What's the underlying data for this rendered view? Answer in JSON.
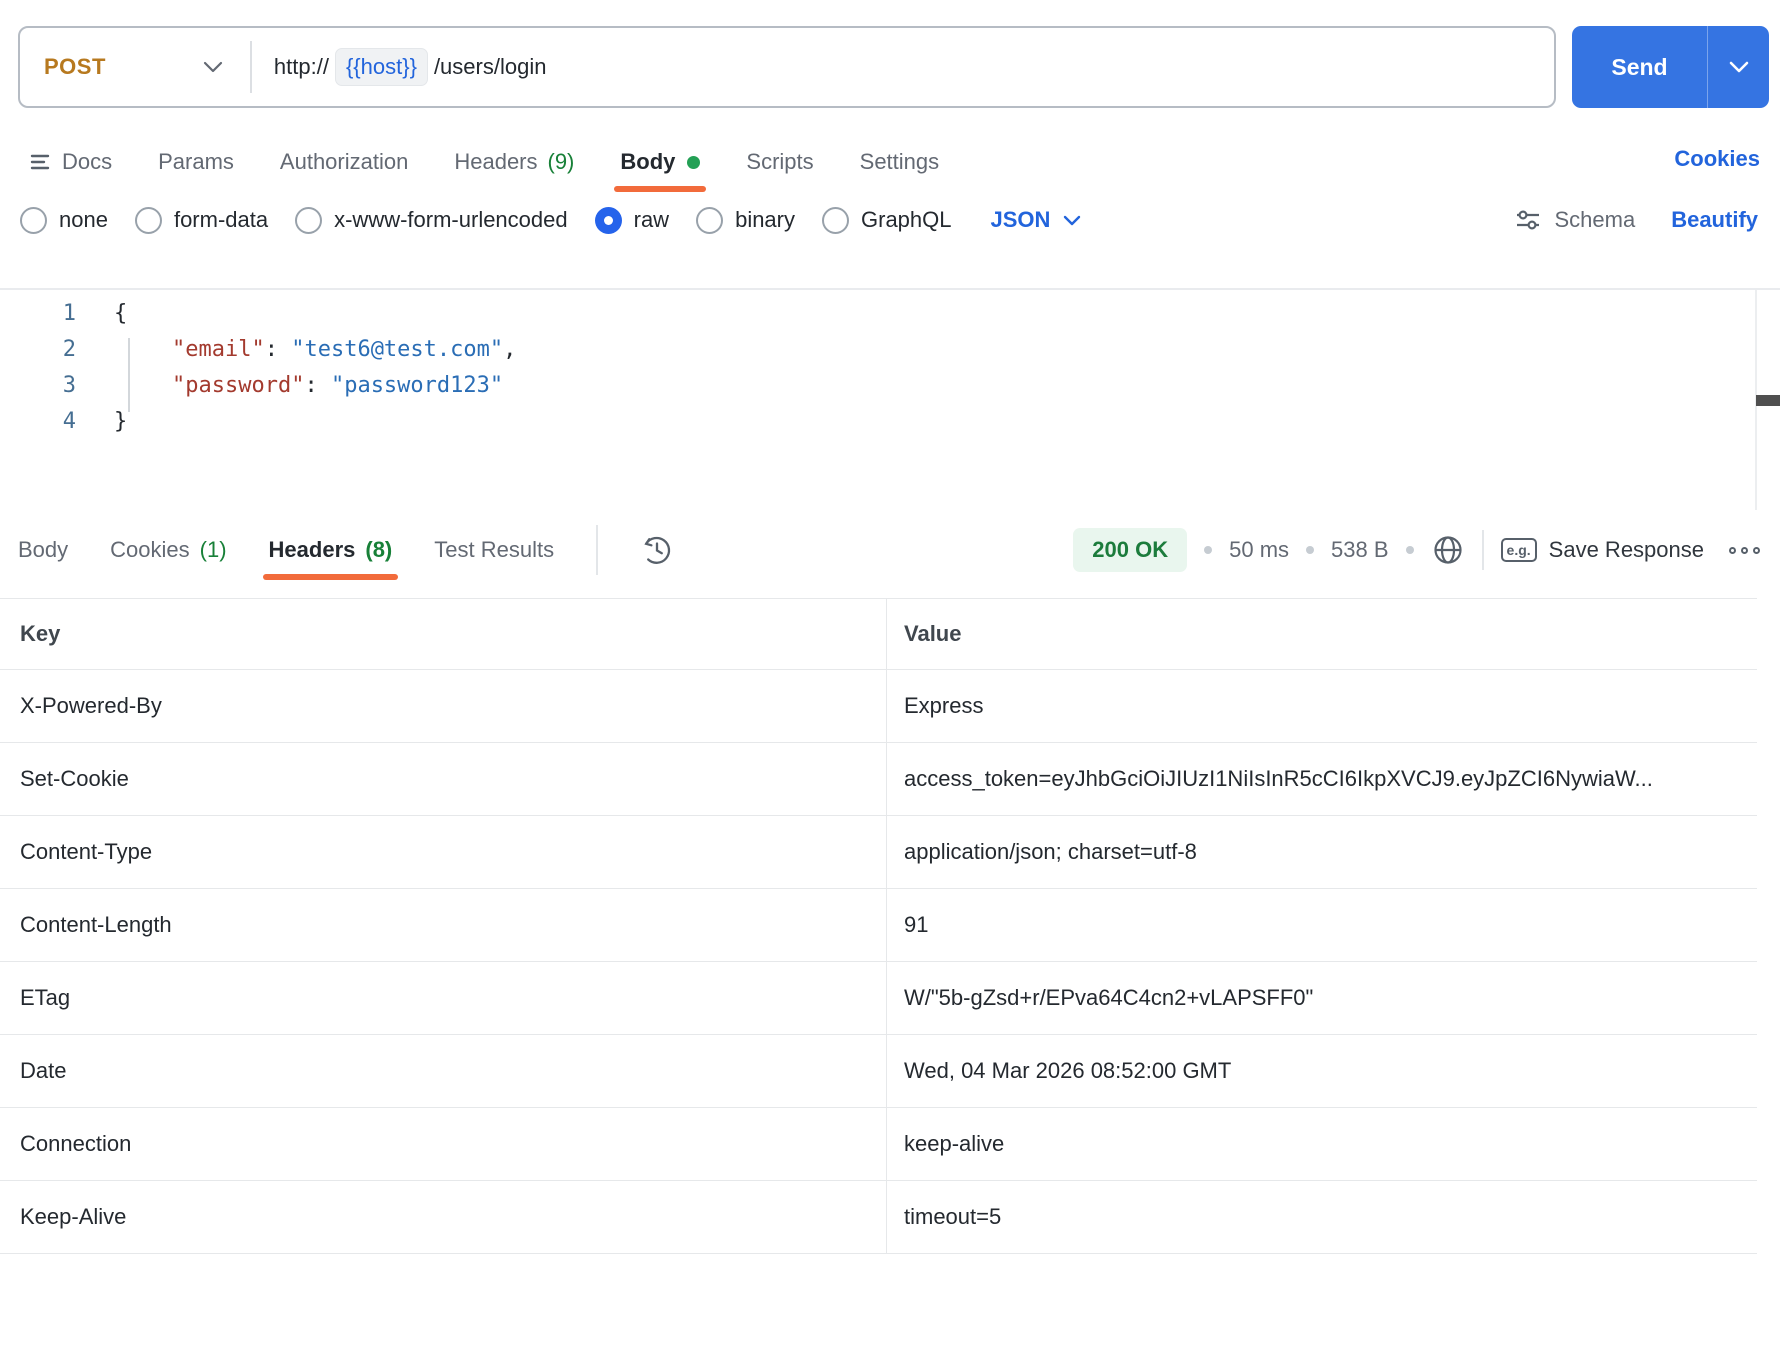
{
  "request_bar": {
    "method": "POST",
    "url_scheme": "http://",
    "url_host_var": "{{host}}",
    "url_path": "/users/login",
    "send_label": "Send"
  },
  "request_tabs": {
    "docs": "Docs",
    "params": "Params",
    "authorization": "Authorization",
    "headers": "Headers",
    "headers_count": "(9)",
    "body": "Body",
    "scripts": "Scripts",
    "settings": "Settings",
    "cookies_link": "Cookies"
  },
  "body_options": {
    "none": "none",
    "form_data": "form-data",
    "urlencoded": "x-www-form-urlencoded",
    "raw": "raw",
    "binary": "binary",
    "graphql": "GraphQL",
    "selected": "raw",
    "language": "JSON",
    "schema": "Schema",
    "beautify": "Beautify"
  },
  "body_editor": {
    "line_numbers": [
      "1",
      "2",
      "3",
      "4"
    ],
    "open_brace": "{",
    "email_key": "\"email\"",
    "colon": ": ",
    "email_value": "\"test6@test.com\"",
    "comma": ",",
    "password_key": "\"password\"",
    "password_value": "\"password123\"",
    "close_brace": "}"
  },
  "response_bar": {
    "tab_body": "Body",
    "tab_cookies": "Cookies",
    "cookies_count": "(1)",
    "tab_headers": "Headers",
    "headers_count": "(8)",
    "tab_tests": "Test Results",
    "status": "200 OK",
    "time": "50 ms",
    "size": "538 B",
    "eg_label": "e.g.",
    "save_label": "Save Response"
  },
  "response_table": {
    "columns": [
      "Key",
      "Value"
    ],
    "rows": [
      {
        "key": "X-Powered-By",
        "value": "Express"
      },
      {
        "key": "Set-Cookie",
        "value": "access_token=eyJhbGciOiJIUzI1NiIsInR5cCI6IkpXVCJ9.eyJpZCI6NywiaW..."
      },
      {
        "key": "Content-Type",
        "value": "application/json; charset=utf-8"
      },
      {
        "key": "Content-Length",
        "value": "91"
      },
      {
        "key": "ETag",
        "value": "W/\"5b-gZsd+r/EPva64C4cn2+vLAPSFF0\""
      },
      {
        "key": "Date",
        "value": "Wed, 04 Mar 2026 08:52:00 GMT"
      },
      {
        "key": "Connection",
        "value": "keep-alive"
      },
      {
        "key": "Keep-Alive",
        "value": "timeout=5"
      }
    ]
  },
  "colors": {
    "method_post": "#b7791f",
    "send_button": "#3574e2",
    "link_blue": "#2264dc",
    "radio_selected": "#2563eb",
    "count_green": "#188038",
    "status_green_text": "#1c7c3c",
    "status_green_bg": "#e9f6ee",
    "active_underline_orange": "#f26b3b",
    "code_key_red": "#a33a2e",
    "code_value_blue": "#2a6db5",
    "line_number_blue": "#456e92"
  }
}
